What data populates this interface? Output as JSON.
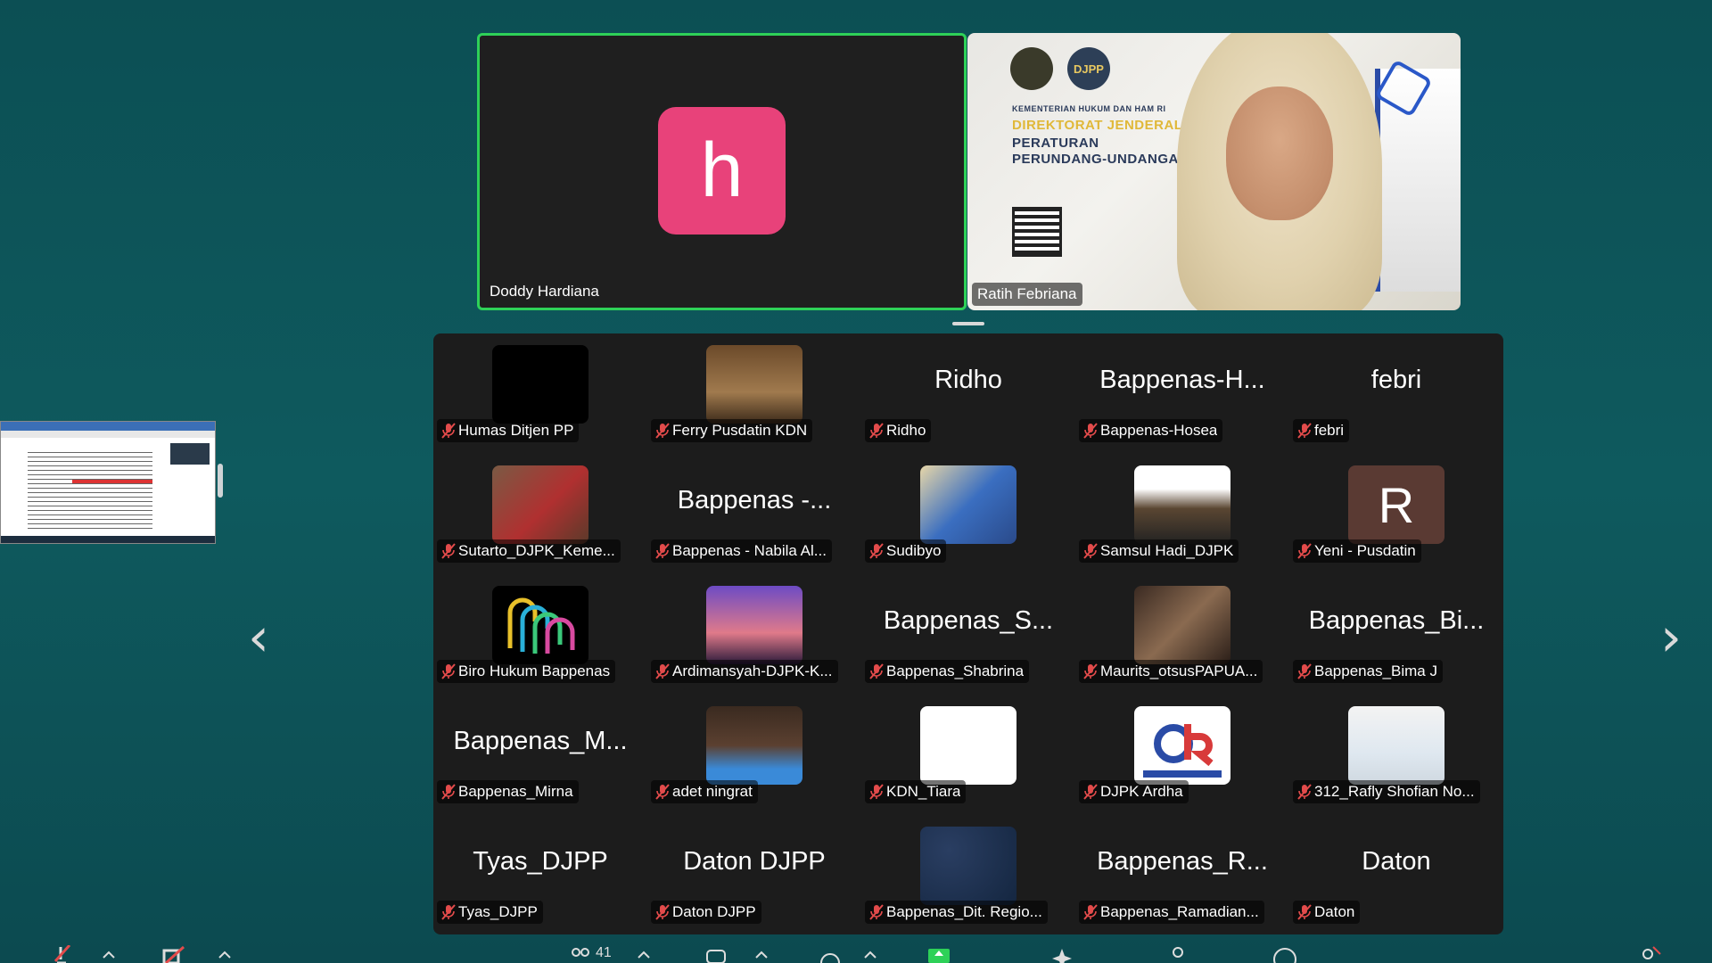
{
  "spotlight": {
    "left": {
      "name": "Doddy Hardiana",
      "avatar_letter": "h",
      "avatar_color": "#e8427a"
    },
    "right": {
      "name": "Ratih Febriana",
      "banner_line1": "KEMENTERIAN HUKUM DAN HAM RI",
      "banner_line2": "DIREKTORAT JENDERAL",
      "banner_line3": "PERATURAN",
      "banner_line4": "PERUNDANG-UNDANGAN",
      "logo_text": "DJPP"
    }
  },
  "participants": [
    {
      "label": "Humas Ditjen PP",
      "big": "",
      "thumb": "black"
    },
    {
      "label": "Ferry Pusdatin KDN",
      "big": "",
      "thumb": "photo-brown"
    },
    {
      "label": "Ridho",
      "big": "Ridho",
      "thumb": ""
    },
    {
      "label": "Bappenas-Hosea",
      "big": "Bappenas-H...",
      "thumb": ""
    },
    {
      "label": "febri",
      "big": "febri",
      "thumb": ""
    },
    {
      "label": "Sutarto_DJPK_Keme...",
      "big": "",
      "thumb": "photo-red"
    },
    {
      "label": "Bappenas - Nabila Al...",
      "big": "Bappenas -...",
      "thumb": ""
    },
    {
      "label": "Sudibyo",
      "big": "",
      "thumb": "photo-blue"
    },
    {
      "label": "Samsul Hadi_DJPK",
      "big": "",
      "thumb": "photo-white"
    },
    {
      "label": "Yeni - Pusdatin",
      "big": "",
      "thumb": "letter-R"
    },
    {
      "label": "Biro Hukum Bappenas",
      "big": "",
      "thumb": "logo-lines"
    },
    {
      "label": "Ardimansyah-DJPK-K...",
      "big": "",
      "thumb": "photo-sunset"
    },
    {
      "label": "Bappenas_Shabrina",
      "big": "Bappenas_S...",
      "thumb": ""
    },
    {
      "label": "Maurits_otsusPAPUA...",
      "big": "",
      "thumb": "photo-dark"
    },
    {
      "label": "Bappenas_Bima J",
      "big": "Bappenas_Bi...",
      "thumb": ""
    },
    {
      "label": "Bappenas_Mirna",
      "big": "Bappenas_M...",
      "thumb": ""
    },
    {
      "label": "adet ningrat",
      "big": "",
      "thumb": "photo-stage"
    },
    {
      "label": "KDN_Tiara",
      "big": "",
      "thumb": "white"
    },
    {
      "label": "DJPK Ardha",
      "big": "",
      "thumb": "logo-dr"
    },
    {
      "label": "312_Rafly Shofian No...",
      "big": "",
      "thumb": "photo-person"
    },
    {
      "label": "Tyas_DJPP",
      "big": "Tyas_DJPP",
      "thumb": ""
    },
    {
      "label": "Daton DJPP",
      "big": "Daton DJPP",
      "thumb": ""
    },
    {
      "label": "Bappenas_Dit. Regio...",
      "big": "",
      "thumb": "photo-space"
    },
    {
      "label": "Bappenas_Ramadian...",
      "big": "Bappenas_R...",
      "thumb": ""
    },
    {
      "label": "Daton",
      "big": "Daton",
      "thumb": ""
    }
  ],
  "R_letter": "R",
  "toolbar": {
    "participants_count": "41"
  },
  "colors": {
    "active_speaker_border": "#2ed158",
    "muted_mic": "#e24b4b",
    "background": "#0e5a5e"
  }
}
